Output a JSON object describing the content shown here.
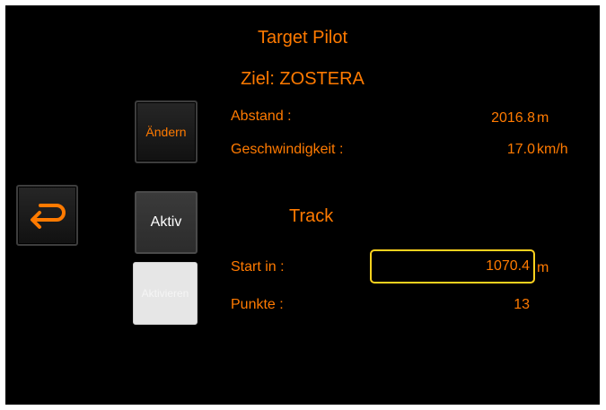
{
  "title": "Target Pilot",
  "target": {
    "label": "Ziel: ZOSTERA"
  },
  "change_button": "Ändern",
  "distance": {
    "label": "Abstand :",
    "value": "2016.8",
    "unit": "m"
  },
  "speed": {
    "label": "Geschwindigkeit :",
    "value": "17.0",
    "unit": "km/h"
  },
  "back_button": {
    "icon": "return-arrow-icon"
  },
  "active_button": "Aktiv",
  "activate_button": "Aktivieren",
  "track": {
    "heading": "Track",
    "start_label": "Start in :",
    "start_value": "1070.4",
    "start_unit": "m",
    "points_label": "Punkte :",
    "points_value": "13"
  },
  "colors": {
    "accent": "#ff7a00",
    "focus": "#ffd21e",
    "background": "#000000"
  }
}
